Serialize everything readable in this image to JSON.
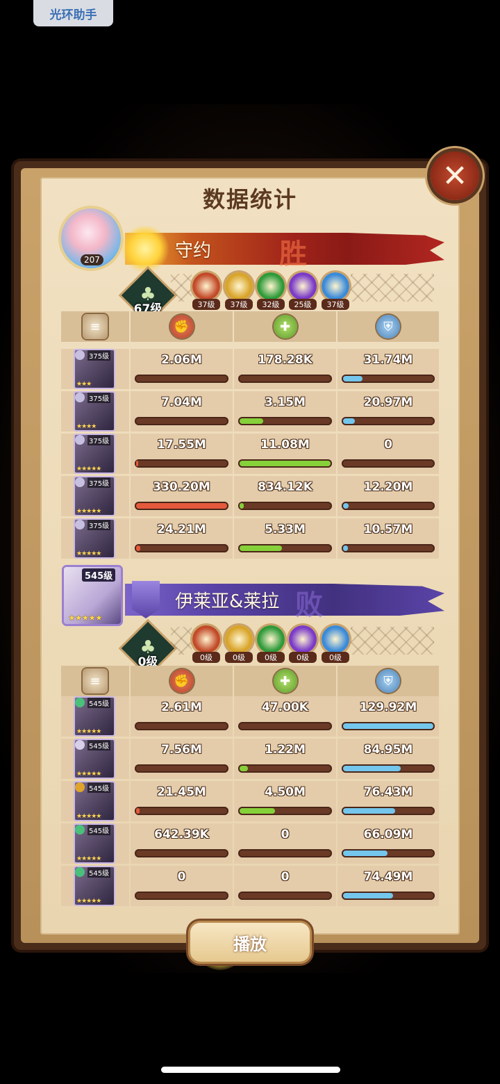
{
  "top_badge": "光环助手",
  "title": "数据统计",
  "close_label": "✕",
  "play_label": "播放",
  "teams": [
    {
      "id": "winner",
      "player_level": "207",
      "name": "守约",
      "result": "胜",
      "tree_level": "67级",
      "factions": [
        {
          "level": "37级",
          "color": "#c24a2a"
        },
        {
          "level": "37级",
          "color": "#d8a42a"
        },
        {
          "level": "32级",
          "color": "#2f9a3a"
        },
        {
          "level": "25级",
          "color": "#7a3ac8"
        },
        {
          "level": "37级",
          "color": "#3a8ad8"
        }
      ],
      "heroes": [
        {
          "level": "375级",
          "stars": "★★★",
          "gem": "#c8c0e0",
          "damage": "2.06M",
          "damage_pct": 0.006,
          "heal": "178.28K",
          "heal_pct": 0.016,
          "defense": "31.74M",
          "defense_pct": 0.24
        },
        {
          "level": "375级",
          "stars": "★★★★",
          "gem": "#c8c0e0",
          "damage": "7.04M",
          "damage_pct": 0.021,
          "heal": "3.15M",
          "heal_pct": 0.28,
          "defense": "20.97M",
          "defense_pct": 0.16
        },
        {
          "level": "375级",
          "stars": "★★★★★",
          "gem": "#c8c0e0",
          "damage": "17.55M",
          "damage_pct": 0.053,
          "heal": "11.08M",
          "heal_pct": 1.0,
          "defense": "0",
          "defense_pct": 0
        },
        {
          "level": "375级",
          "stars": "★★★★★",
          "gem": "#c8c0e0",
          "damage": "330.20M",
          "damage_pct": 1.0,
          "heal": "834.12K",
          "heal_pct": 0.075,
          "defense": "12.20M",
          "defense_pct": 0.09
        },
        {
          "level": "375级",
          "stars": "★★★★★",
          "gem": "#c8c0e0",
          "damage": "24.21M",
          "damage_pct": 0.073,
          "heal": "5.33M",
          "heal_pct": 0.48,
          "defense": "10.57M",
          "defense_pct": 0.08
        }
      ]
    },
    {
      "id": "loser",
      "player_level": "545级",
      "player_stars": "★★★★★",
      "name": "伊莱亚&莱拉",
      "result": "败",
      "tree_level": "0级",
      "factions": [
        {
          "level": "0级",
          "color": "#c24a2a"
        },
        {
          "level": "0级",
          "color": "#d8a42a"
        },
        {
          "level": "0级",
          "color": "#2f9a3a"
        },
        {
          "level": "0级",
          "color": "#7a3ac8"
        },
        {
          "level": "0级",
          "color": "#3a8ad8"
        }
      ],
      "heroes": [
        {
          "level": "545级",
          "stars": "★★★★★",
          "gem": "#4ac07a",
          "damage": "2.61M",
          "damage_pct": 0.004,
          "heal": "47.00K",
          "heal_pct": 0.01,
          "defense": "129.92M",
          "defense_pct": 1.0
        },
        {
          "level": "545级",
          "stars": "★★★★★",
          "gem": "#d8d0e8",
          "damage": "7.56M",
          "damage_pct": 0.012,
          "heal": "1.22M",
          "heal_pct": 0.12,
          "defense": "84.95M",
          "defense_pct": 0.65
        },
        {
          "level": "545级",
          "stars": "★★★★★",
          "gem": "#e0a42a",
          "damage": "21.45M",
          "damage_pct": 0.065,
          "heal": "4.50M",
          "heal_pct": 0.41,
          "defense": "76.43M",
          "defense_pct": 0.59
        },
        {
          "level": "545级",
          "stars": "★★★★★",
          "gem": "#4ac07a",
          "damage": "642.39K",
          "damage_pct": 0.001,
          "heal": "0",
          "heal_pct": 0,
          "defense": "66.09M",
          "defense_pct": 0.51
        },
        {
          "level": "545级",
          "stars": "★★★★★",
          "gem": "#4ac07a",
          "damage": "0",
          "damage_pct": 0,
          "heal": "0",
          "heal_pct": 0,
          "defense": "74.49M",
          "defense_pct": 0.57
        }
      ]
    }
  ],
  "icons": {
    "stats_header": "scroll-icon",
    "damage": "damage-icon",
    "heal": "heal-icon",
    "defense": "shield-icon",
    "tree": "tree-icon"
  },
  "colors": {
    "damage_bar": "#e55a3c",
    "heal_bar": "#86d03a",
    "defense_bar": "#74c6ec"
  }
}
